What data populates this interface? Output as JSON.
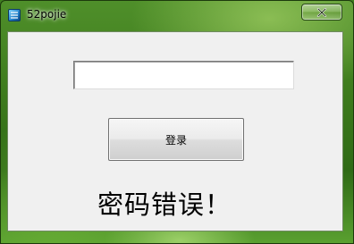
{
  "window": {
    "title": "52pojie",
    "close_glyph": "✕",
    "icon": "app-icon"
  },
  "form": {
    "password_value": "",
    "login_label": "登录",
    "error_text": "密码错误！"
  },
  "colors": {
    "client_background": "#f0f0f0",
    "frame_green": "#3d7a1c",
    "text": "#000000"
  }
}
